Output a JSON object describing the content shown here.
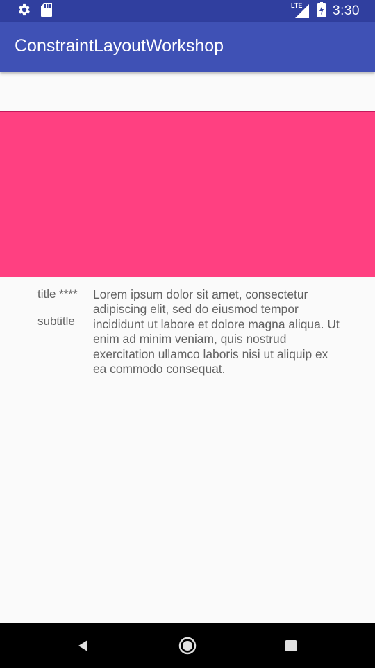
{
  "status_bar": {
    "left_icons": [
      "settings-icon",
      "sd-card-icon"
    ],
    "right_icons": [
      "lte-signal-icon",
      "battery-charging-icon"
    ],
    "network_label": "LTE",
    "time": "3:30"
  },
  "app_bar": {
    "title": "ConstraintLayoutWorkshop"
  },
  "colors": {
    "status_bar": "#303f9f",
    "app_bar": "#3f51b5",
    "accent": "#ff4081",
    "background": "#fafafa",
    "text": "#616161"
  },
  "content": {
    "title": "title ****",
    "subtitle": "subtitle",
    "body": "Lorem ipsum dolor sit amet, consectetur adipiscing elit, sed do eiusmod tempor incididunt ut labore et dolore magna aliqua. Ut enim ad minim veniam, quis nostrud exercitation ullamco laboris nisi ut aliquip ex ea commodo consequat."
  },
  "nav_bar": {
    "buttons": [
      "back-icon",
      "home-icon",
      "recents-icon"
    ]
  }
}
